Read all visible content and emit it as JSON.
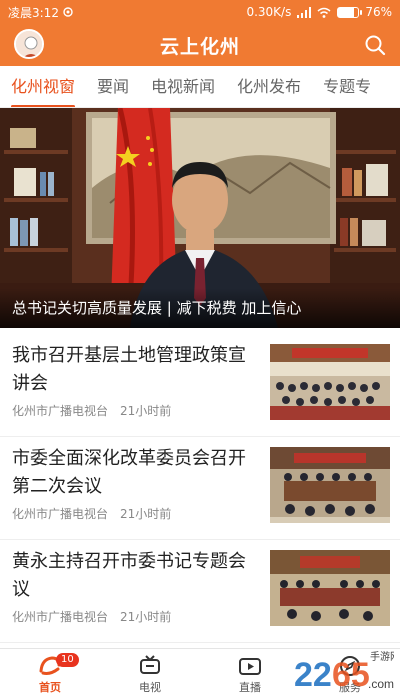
{
  "status_bar": {
    "time": "凌晨3:12",
    "net_speed": "0.30K/s",
    "battery": "76%",
    "battery_level": 0.76
  },
  "header": {
    "title": "云上化州"
  },
  "tabs": [
    {
      "label": "化州视窗",
      "active": true
    },
    {
      "label": "要闻",
      "active": false
    },
    {
      "label": "电视新闻",
      "active": false
    },
    {
      "label": "化州发布",
      "active": false
    },
    {
      "label": "专题专",
      "active": false
    }
  ],
  "hero": {
    "caption": "总书记关切高质量发展 | 减下税费 加上信心"
  },
  "news": [
    {
      "title": "我市召开基层土地管理政策宣讲会",
      "source": "化州市广播电视台",
      "time": "21小时前"
    },
    {
      "title": "市委全面深化改革委员会召开第二次会议",
      "source": "化州市广播电视台",
      "time": "21小时前"
    },
    {
      "title": "黄永主持召开市委书记专题会议",
      "source": "化州市广播电视台",
      "time": "21小时前"
    }
  ],
  "bottom_nav": [
    {
      "label": "首页",
      "icon": "home-icon",
      "active": true,
      "badge": "10"
    },
    {
      "label": "电视",
      "icon": "tv-icon",
      "active": false
    },
    {
      "label": "直播",
      "icon": "live-icon",
      "active": false
    },
    {
      "label": "服务",
      "icon": "compass-icon",
      "active": false
    }
  ],
  "watermark": {
    "brand": "2265",
    "subtitle": "手游网",
    "url": ".com"
  },
  "colors": {
    "accent": "#f07a32",
    "active_tab": "#e8521e"
  }
}
